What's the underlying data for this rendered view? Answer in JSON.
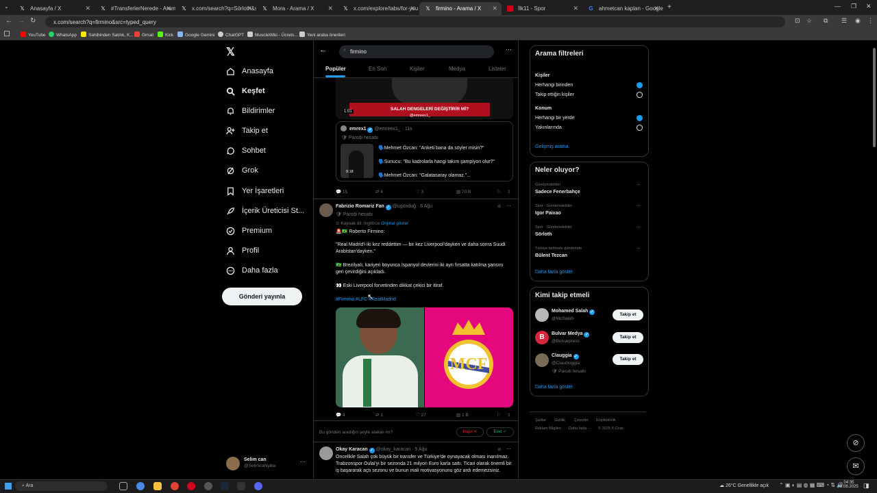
{
  "browser": {
    "tabs": [
      {
        "title": "Anasayfa / X",
        "icon": "x-icon"
      },
      {
        "title": "#TransferlerNerede - Arama / X",
        "icon": "x-icon"
      },
      {
        "title": "x.com/search?q=Sörloth&src=...",
        "icon": "x-icon"
      },
      {
        "title": "Mora - Arama / X",
        "icon": "x-icon"
      },
      {
        "title": "x.com/explore/tabs/for-you",
        "icon": "x-icon"
      },
      {
        "title": "firmino - Arama / X",
        "icon": "x-icon"
      },
      {
        "title": "İlk11 - Spor",
        "icon": "ilk11-icon"
      },
      {
        "title": "ahmetcan kaplan - Google'da A...",
        "icon": "google-icon"
      }
    ],
    "url": "x.com/search?q=firmino&src=typed_query",
    "bookmarks": [
      "YouTube",
      "WhatsApp",
      "Sahibinden Satılık, K...",
      "Gmail",
      "Kick",
      "Google Gemini",
      "ChatGPT",
      "MuscleWiki - Ücrets...",
      "Yeni araba önerileri"
    ]
  },
  "leftnav": {
    "items": [
      "Anasayfa",
      "Keşfet",
      "Bildirimler",
      "Takip et",
      "Sohbet",
      "Grok",
      "Yer İşaretleri",
      "İçerik Üreticisi St...",
      "Premium",
      "Profil",
      "Daha fazla"
    ],
    "post_button": "Gönderi yayınla",
    "user": {
      "name": "Selim can",
      "handle": "@SelimcaNyiba"
    }
  },
  "search": {
    "query": "firmino",
    "tabs": [
      "Popüler",
      "En Son",
      "Kişiler",
      "Medya",
      "Listeler"
    ]
  },
  "post0": {
    "video_time": "1:01",
    "video_caption": "SALAH DENGELERİ DEĞİŞTİRİR Mİ?",
    "video_handle": "@emreex1_",
    "quote": {
      "name": "emrex1",
      "handle": "@emreex1_ · 11s",
      "label": "Parodi hesabı",
      "lines": [
        "🗣️Mehmet Özcan: \"Anketi bana da söyler misin?\"",
        "🗣️Sunucu: \"Bu kadrolarla hangi takım şampiyon olur?\"",
        "🗣️Mehmet Özcan: \"Galatasaray olamaz.\"..."
      ],
      "thumb_time": "0:18"
    },
    "stats": {
      "reply": "15",
      "retweet": "4",
      "like": "3",
      "views": "70 B"
    }
  },
  "post1": {
    "name": "Fabrizio Romariz Fan",
    "handle": "@ugonduğ · 6 Ağu",
    "label": "Parodi hesabı",
    "translate": "Kaynak dil: İngilizce",
    "translate_link": "Orijinal göster",
    "lines": [
      "🚨🇧🇷 Roberto Firmino:",
      "\"Real Madrid'i iki kez reddettim — bir kez Liverpool'dayken ve daha sonra Suudi Arabistan'dayken.\"",
      "🇧🇷 Brezilyalı, kariyeri boyunca İspanyol devlerini iki ayrı fırsatta katılma şansını geri çevirdiğini açıkladı.",
      "👀 Eski Liverpool forvetinden dikkat çekici bir itiraf."
    ],
    "hashtags": "#Firmino #LFC #RealMadrid",
    "stats": {
      "reply": "4",
      "retweet": "1",
      "like": "27",
      "views": "1 B"
    }
  },
  "feedback": {
    "question": "Bu gönderi aradığın şeyle alakalı mı?",
    "no": "Hayır ✕",
    "yes": "Evet ✓"
  },
  "post2": {
    "name": "Okay Karacan",
    "handle": "@okay_karacan · 5 Ağu",
    "text": "Öncelikle Salah çok büyük bir transfer ve Türkiye'de oynayacak olması inanılmaz. Trabzonspor Oulai'yi bir sezonda 21 milyon Euro karla sattı. Ticari olarak önemli bir iş başararak açtı sezonu ve bunun mali motivasyonunu göz ardı edemezsiniz."
  },
  "filters": {
    "title": "Arama filtreleri",
    "people_label": "Kişiler",
    "people": [
      {
        "label": "Herhangi birinden",
        "checked": true
      },
      {
        "label": "Takip ettiğin kişiler",
        "checked": false
      }
    ],
    "location_label": "Konum",
    "location": [
      {
        "label": "Herhangi bir yerde",
        "checked": true
      },
      {
        "label": "Yakınlarında",
        "checked": false
      }
    ],
    "advanced": "Gelişmiş arama"
  },
  "trends": {
    "title": "Neler oluyor?",
    "items": [
      {
        "context": "Gündemdekiler",
        "name": "Sadece Fenerbahçe"
      },
      {
        "context": "Spor · Gündemdekiler",
        "name": "Igor Paixao"
      },
      {
        "context": "Spor · Gündemdekiler",
        "name": "Sörloth"
      },
      {
        "context": "Türkiye tarihinde gündemde",
        "name": "Bülent Tezcan"
      }
    ],
    "more": "Daha fazla göster"
  },
  "whotofollow": {
    "title": "Kimi takip etmeli",
    "items": [
      {
        "name": "Mohamed Salah",
        "handle": "@MoSalah",
        "sub": ""
      },
      {
        "name": "Bulvar Medya",
        "handle": "@Bulvarpress",
        "sub": ""
      },
      {
        "name": "Clauggia",
        "handle": "@Claudioggia",
        "sub": "Parodi hesabı"
      }
    ],
    "button": "Takip et",
    "more": "Daha fazla göster"
  },
  "footer": [
    "Şartlar",
    "Gizlilik",
    "Çerezler",
    "Erişilebilirlik",
    "Reklam Bilgileri",
    "Daha fazla ···",
    "© 2025 X Corp."
  ],
  "taskbar": {
    "search": "Ara",
    "weather": "26°C  Genellikle açık",
    "time": "04:35",
    "date": "8.08.2025"
  },
  "colors": {
    "accent": "#1d9bf0",
    "bg": "#000000",
    "border": "#2f3336"
  }
}
